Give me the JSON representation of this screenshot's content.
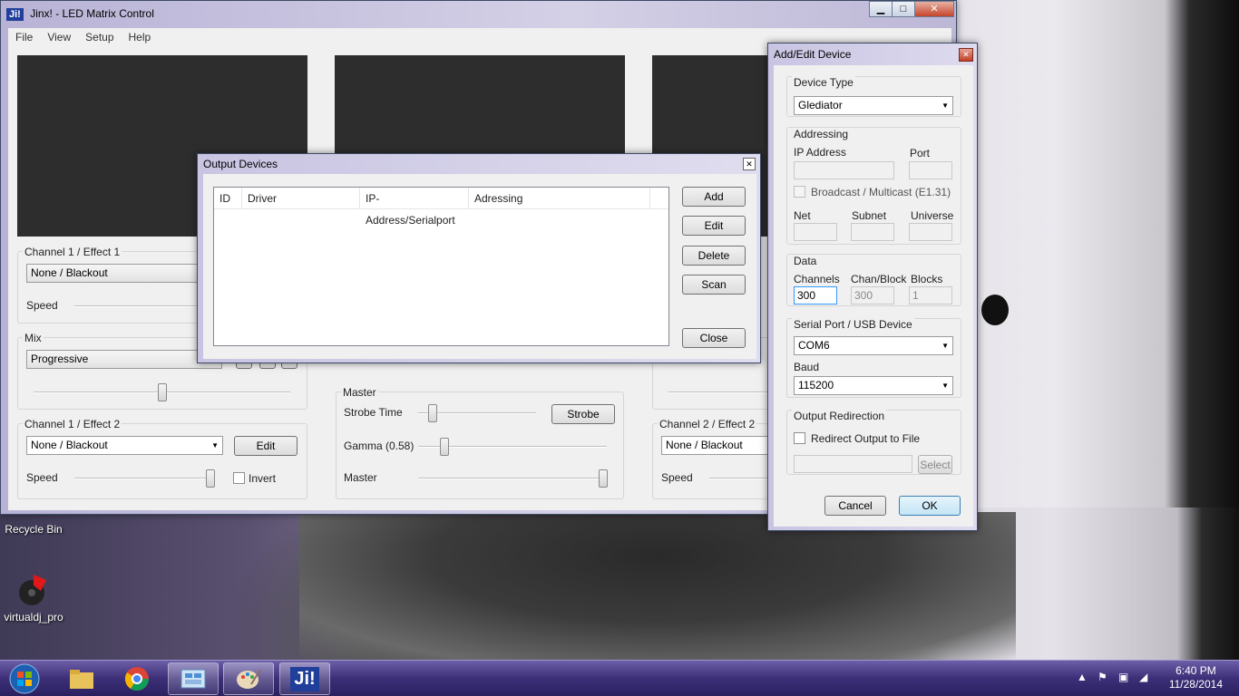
{
  "desktop": {
    "icons": [
      {
        "label": "Recycle Bin"
      },
      {
        "label": "virtualdj_pro"
      }
    ]
  },
  "main_window": {
    "logo": "Ji!",
    "title": "Jinx! - LED Matrix Control",
    "caption": {
      "minimize": "▁",
      "maximize": "□",
      "close": "✕"
    },
    "menu": [
      "File",
      "View",
      "Setup",
      "Help"
    ],
    "ch1_effect1": {
      "group": "Channel 1 / Effect 1",
      "effect": "None / Blackout",
      "speed_label": "Speed"
    },
    "mix": {
      "group": "Mix",
      "value": "Progressive"
    },
    "ch1_effect2": {
      "group": "Channel 1 / Effect 2",
      "effect": "None / Blackout",
      "edit": "Edit",
      "speed_label": "Speed",
      "invert": "Invert"
    },
    "master": {
      "group": "Master",
      "strobe_time": "Strobe Time",
      "strobe": "Strobe",
      "gamma": "Gamma (0.58)",
      "master": "Master"
    },
    "ch2_effect2": {
      "group": "Channel 2 / Effect 2",
      "effect": "None / Blackout",
      "speed_label": "Speed"
    }
  },
  "output_devices": {
    "title": "Output Devices",
    "close_glyph": "✕",
    "columns": [
      "ID",
      "Driver",
      "IP-Address/Serialport",
      "Adressing"
    ],
    "buttons": {
      "add": "Add",
      "edit": "Edit",
      "delete": "Delete",
      "scan": "Scan",
      "close": "Close"
    }
  },
  "add_edit_device": {
    "title": "Add/Edit Device",
    "close_glyph": "✕",
    "device_type": {
      "group": "Device Type",
      "value": "Glediator"
    },
    "addressing": {
      "group": "Addressing",
      "ip_label": "IP Address",
      "port_label": "Port",
      "broadcast": "Broadcast / Multicast (E1.31)",
      "net_label": "Net",
      "subnet_label": "Subnet",
      "universe_label": "Universe"
    },
    "data": {
      "group": "Data",
      "channels_label": "Channels",
      "chan_block_label": "Chan/Block",
      "blocks_label": "Blocks",
      "channels": "300",
      "chan_block": "300",
      "blocks": "1"
    },
    "serial": {
      "group": "Serial Port / USB Device",
      "port": "COM6",
      "baud_label": "Baud",
      "baud": "115200"
    },
    "redirect": {
      "group": "Output Redirection",
      "checkbox": "Redirect Output to File",
      "select": "Select"
    },
    "cancel": "Cancel",
    "ok": "OK"
  },
  "taskbar": {
    "time": "6:40 PM",
    "date": "11/28/2014",
    "jinx_label": "Ji!"
  }
}
